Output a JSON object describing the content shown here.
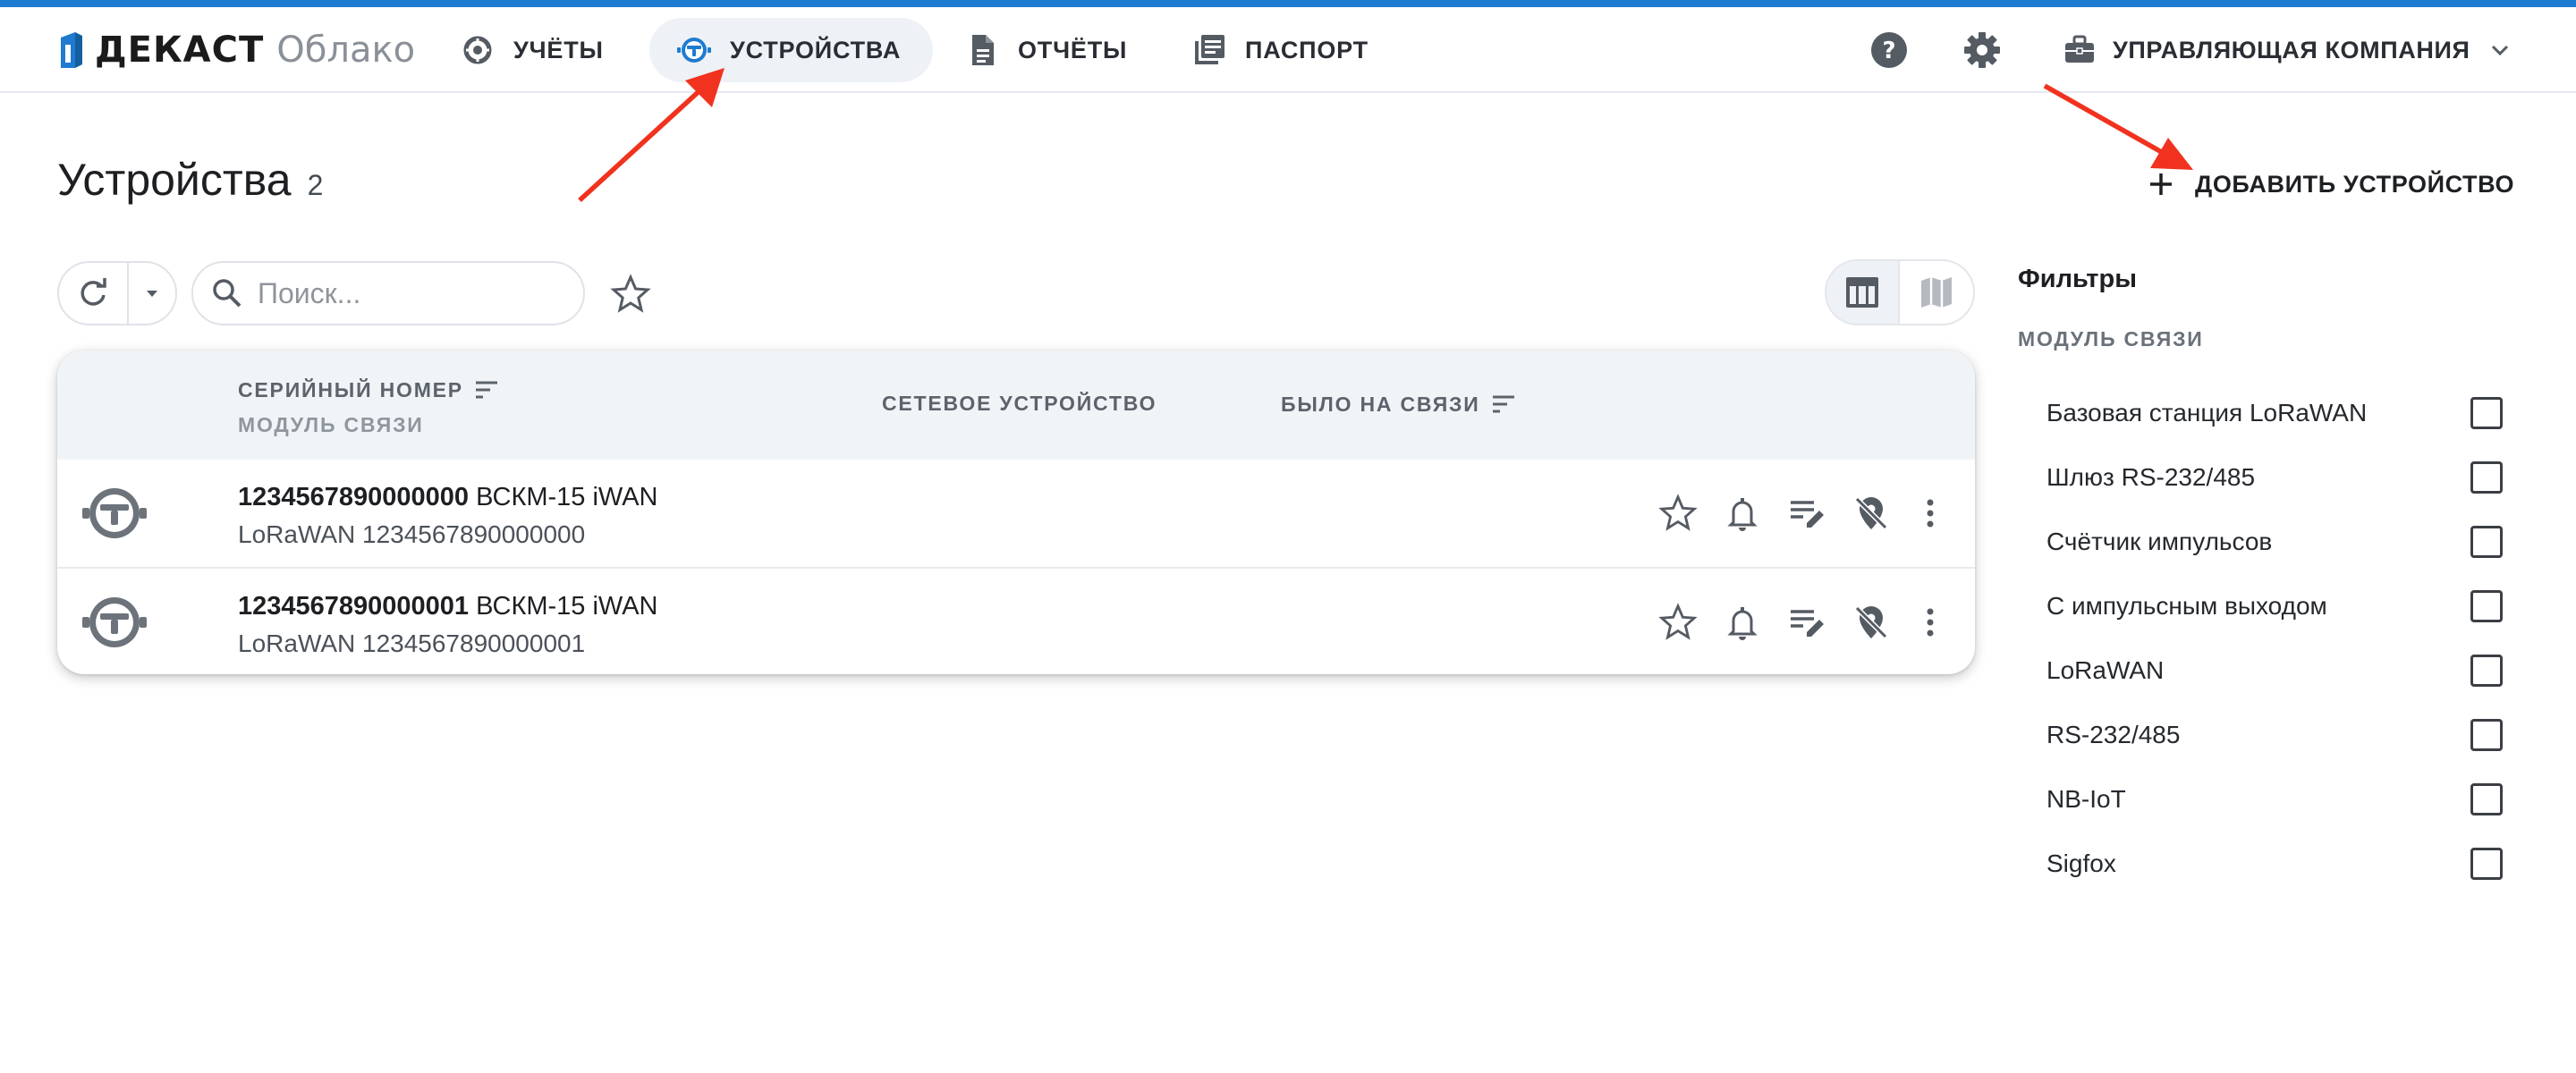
{
  "colors": {
    "accent": "#1e7bd0",
    "arrow": "#f0321e",
    "active_nav_bg": "#eef1f5"
  },
  "header": {
    "logo_text": "ДЕКАСТ",
    "logo_sub": "Облако",
    "nav": [
      {
        "label": "УЧЁТЫ",
        "icon": "meter-dial-icon"
      },
      {
        "label": "УСТРОЙСТВА",
        "icon": "device-icon",
        "active": true
      },
      {
        "label": "ОТЧЁТЫ",
        "icon": "document-icon"
      },
      {
        "label": "ПАСПОРТ",
        "icon": "passport-icon"
      }
    ],
    "help_icon": "help-icon",
    "settings_icon": "gear-icon",
    "company_label": "УПРАВЛЯЮЩАЯ КОМПАНИЯ"
  },
  "page": {
    "title": "Устройства",
    "count": "2",
    "add_button": "ДОБАВИТЬ УСТРОЙСТВО"
  },
  "toolbar": {
    "search_placeholder": "Поиск...",
    "search_value": ""
  },
  "table": {
    "columns": {
      "serial": "СЕРИЙНЫЙ НОМЕР",
      "module": "МОДУЛЬ СВЯЗИ",
      "network": "СЕТЕВОЕ УСТРОЙСТВО",
      "last_seen": "БЫЛО НА СВЯЗИ"
    },
    "rows": [
      {
        "serial": "1234567890000000",
        "model": "ВСКМ-15 iWAN",
        "module": "LoRaWAN 1234567890000000"
      },
      {
        "serial": "1234567890000001",
        "model": "ВСКМ-15 iWAN",
        "module": "LoRaWAN 1234567890000001"
      }
    ]
  },
  "filters": {
    "title": "Фильтры",
    "group_label": "МОДУЛЬ СВЯЗИ",
    "items": [
      {
        "label": "Базовая станция LoRaWAN",
        "checked": false
      },
      {
        "label": "Шлюз RS-232/485",
        "checked": false
      },
      {
        "label": "Счётчик импульсов",
        "checked": false
      },
      {
        "label": "С импульсным выходом",
        "checked": false
      },
      {
        "label": "LoRaWAN",
        "checked": false
      },
      {
        "label": "RS-232/485",
        "checked": false
      },
      {
        "label": "NB-IoT",
        "checked": false
      },
      {
        "label": "Sigfox",
        "checked": false
      }
    ]
  }
}
